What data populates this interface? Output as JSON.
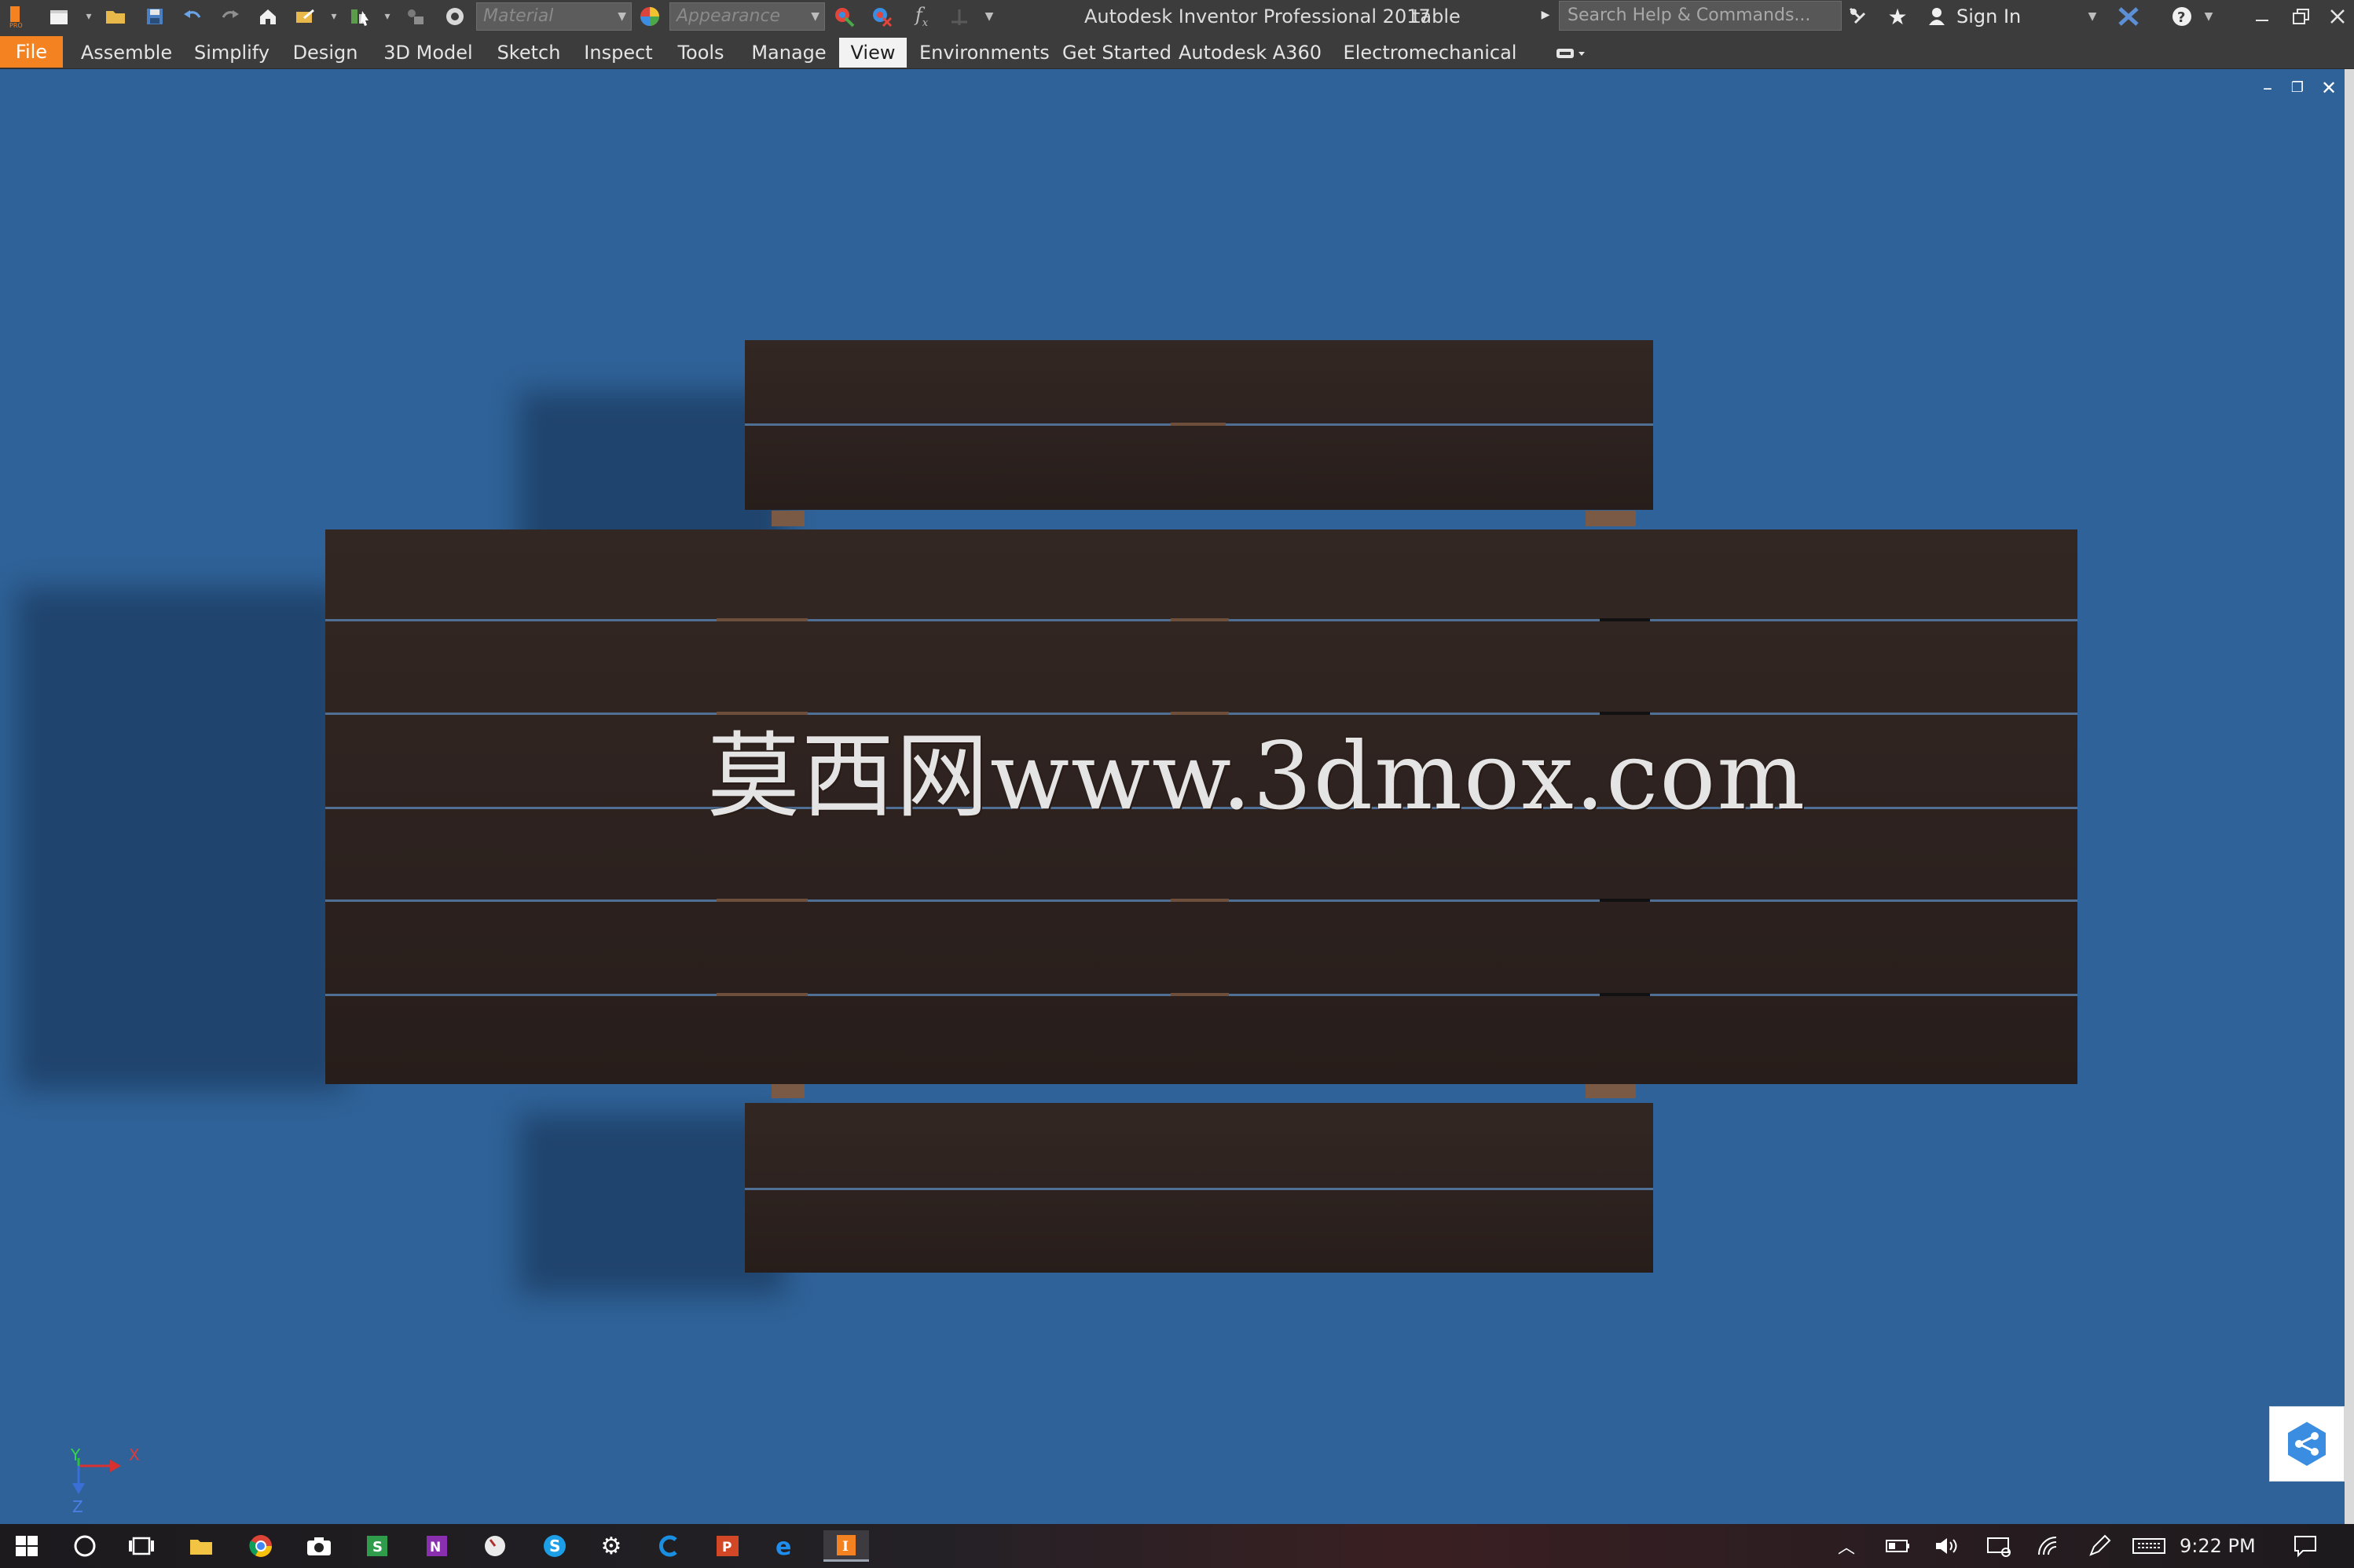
{
  "window": {
    "app_title": "Autodesk Inventor Professional 2017",
    "document_name": "table"
  },
  "quick_access": {
    "material_placeholder": "Material",
    "appearance_placeholder": "Appearance",
    "icons": [
      "app-logo-icon",
      "new-file-icon",
      "open-file-icon",
      "save-icon",
      "undo-icon",
      "redo-icon",
      "home-icon",
      "return-icon",
      "select-icon",
      "update-icon",
      "rebuild-icon",
      "material-sphere-icon",
      "appearance-sphere-icon",
      "adjust-appearance-icon",
      "clear-appearance-icon",
      "fx-icon",
      "measure-icon",
      "customize-icon"
    ]
  },
  "search": {
    "placeholder": "Search Help & Commands...",
    "sign_in": "Sign In"
  },
  "ribbon": {
    "tabs": [
      "File",
      "Assemble",
      "Simplify",
      "Design",
      "3D Model",
      "Sketch",
      "Inspect",
      "Tools",
      "Manage",
      "View",
      "Environments",
      "Get Started",
      "Autodesk A360",
      "Electromechanical"
    ],
    "active_tab": "View"
  },
  "viewport": {
    "watermark": "莫西网www.3dmox.com",
    "background_color": "#2f6298",
    "model_color": "#2e2320",
    "triad": {
      "x_label": "X",
      "y_label": "Y",
      "z_label": "Z"
    }
  },
  "taskbar": {
    "time": "9:22 PM",
    "apps": [
      "start-icon",
      "cortana-icon",
      "task-view-icon",
      "file-explorer-icon",
      "chrome-icon",
      "camera-icon",
      "sway-icon",
      "onenote-icon",
      "clock-app-icon",
      "skype-icon",
      "settings-icon",
      "ccleaner-icon",
      "powerpoint-icon",
      "edge-icon",
      "inventor-icon"
    ],
    "tray": [
      "chevron-up-icon",
      "battery-icon",
      "volume-icon",
      "display-icon",
      "wifi-icon",
      "pen-icon",
      "keyboard-icon",
      "notification-icon"
    ]
  }
}
